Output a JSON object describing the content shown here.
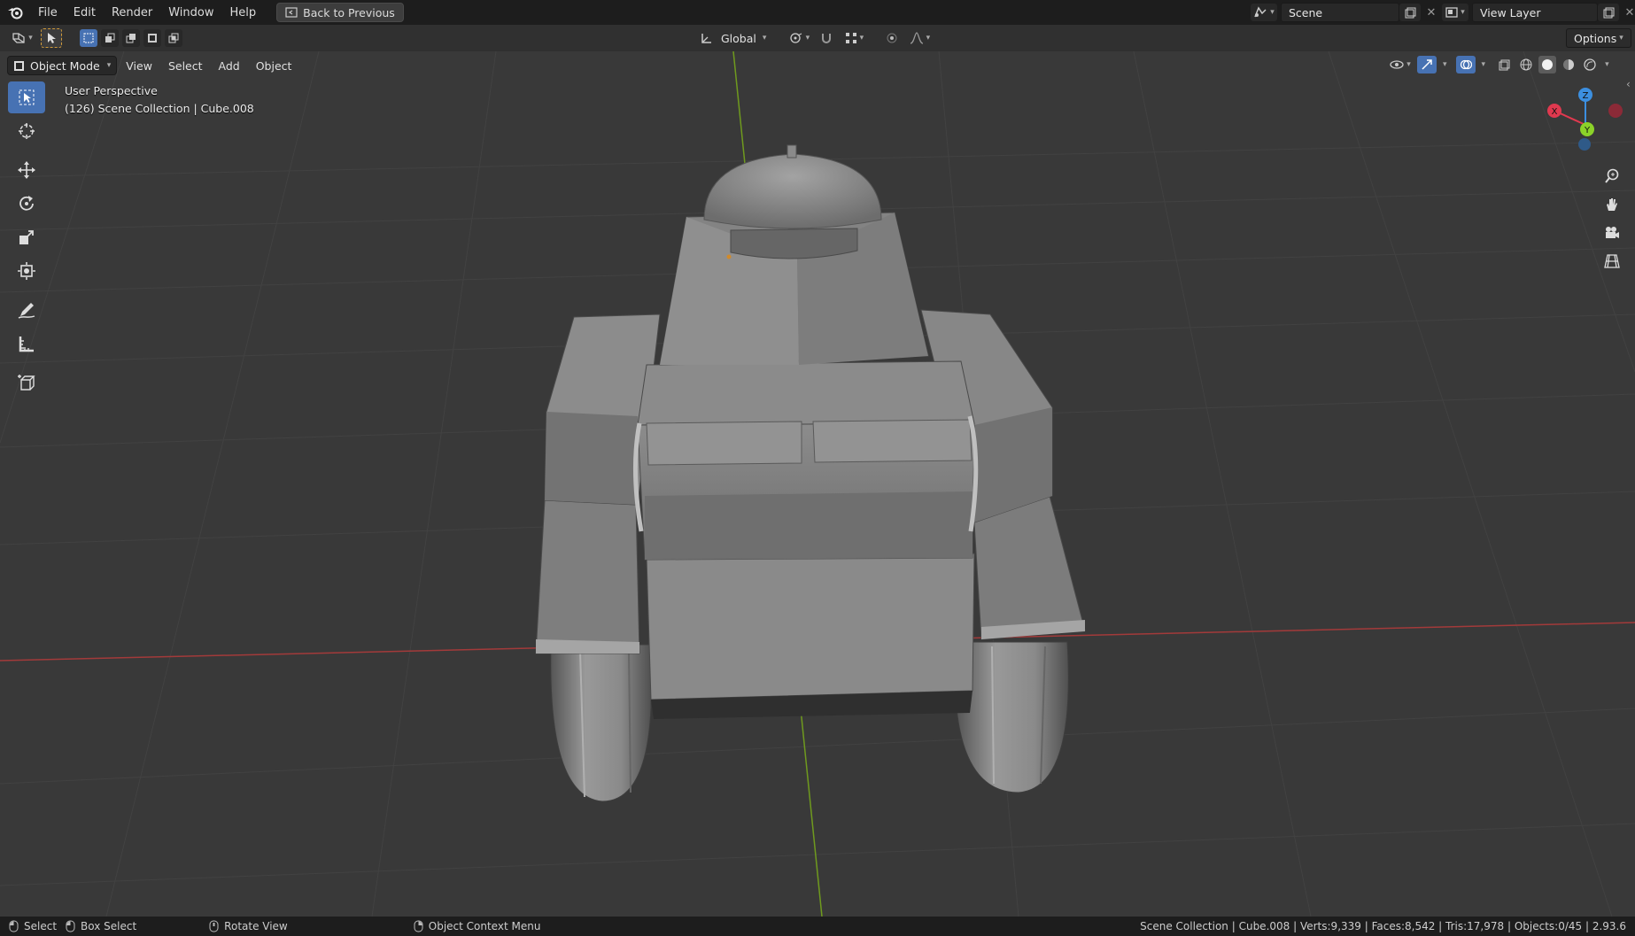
{
  "topbar": {
    "menus": [
      "File",
      "Edit",
      "Render",
      "Window",
      "Help"
    ],
    "back_button": "Back to Previous",
    "scene_name": "Scene",
    "view_layer": "View Layer"
  },
  "header": {
    "transform_orientation": "Global",
    "options_label": "Options"
  },
  "viewport_header": {
    "mode": "Object Mode",
    "menus": [
      "View",
      "Select",
      "Add",
      "Object"
    ]
  },
  "viewport": {
    "view_name": "User Perspective",
    "collection_info": "(126) Scene Collection | Cube.008"
  },
  "gizmo": {
    "axes": [
      "X",
      "Y",
      "Z"
    ],
    "colors": {
      "x": "#e0394f",
      "y": "#8bd229",
      "z": "#3c8fe0"
    }
  },
  "statusbar": {
    "select": "Select",
    "box_select": "Box Select",
    "rotate_view": "Rotate View",
    "context_menu": "Object Context Menu",
    "stats": "Scene Collection | Cube.008 | Verts:9,339 | Faces:8,542 | Tris:17,978 | Objects:0/45 | 2.93.6"
  },
  "colors": {
    "accent": "#4772b3",
    "viewport_bg": "#393939",
    "grid_line": "#454545",
    "x_axis": "#a33a3a",
    "y_axis": "#6f9a1e"
  }
}
